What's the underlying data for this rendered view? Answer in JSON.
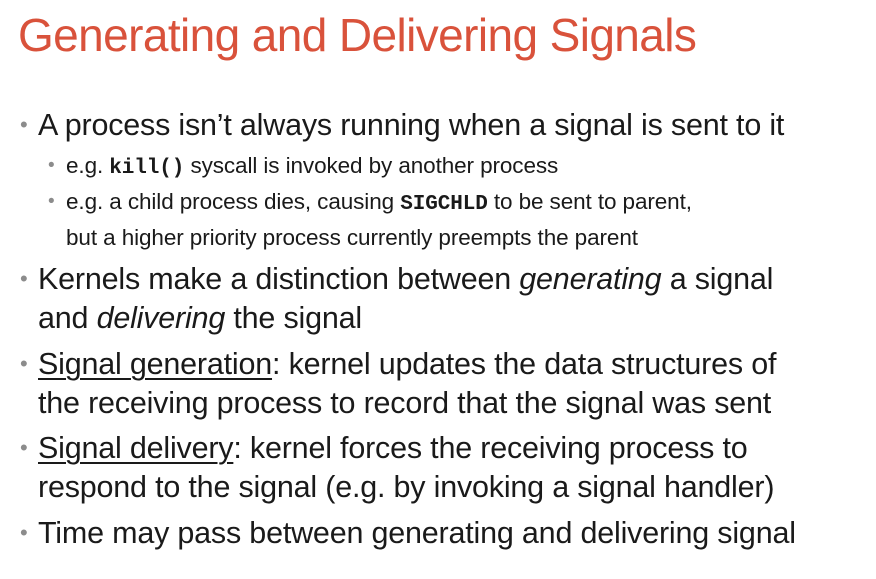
{
  "slide": {
    "title": "Generating and Delivering Signals",
    "title_color": "#d9523b",
    "bullet_color": "#8c8c8c",
    "bullets": [
      {
        "level": 1,
        "parts": [
          {
            "text": "A process isn’t always running when a signal is sent to it"
          }
        ]
      },
      {
        "level": 2,
        "parts": [
          {
            "text": "e.g. "
          },
          {
            "text": "kill()",
            "code": true
          },
          {
            "text": " syscall is invoked by another process"
          }
        ]
      },
      {
        "level": 2,
        "parts": [
          {
            "text": "e.g. a child process dies, causing "
          },
          {
            "text": "SIGCHLD",
            "code": true
          },
          {
            "text": " to be sent to parent,"
          }
        ],
        "continuation": "but a higher priority process currently preempts the parent"
      },
      {
        "level": 1,
        "parts": [
          {
            "text": "Kernels make a distinction between "
          },
          {
            "text": "generating",
            "italic": true
          },
          {
            "text": " a signal"
          }
        ],
        "continuation_parts": [
          {
            "text": "and "
          },
          {
            "text": "delivering",
            "italic": true
          },
          {
            "text": " the signal"
          }
        ]
      },
      {
        "level": 1,
        "parts": [
          {
            "text": "Signal generation",
            "underline": true
          },
          {
            "text": ":  kernel updates the data structures of"
          }
        ],
        "continuation": "the receiving process to record that the signal was sent"
      },
      {
        "level": 1,
        "parts": [
          {
            "text": "Signal delivery",
            "underline": true
          },
          {
            "text": ":  kernel forces the receiving process to"
          }
        ],
        "continuation": "respond to the signal (e.g. by invoking a signal handler)"
      },
      {
        "level": 1,
        "parts": [
          {
            "text": "Time may pass between generating and delivering signal"
          }
        ]
      }
    ]
  }
}
